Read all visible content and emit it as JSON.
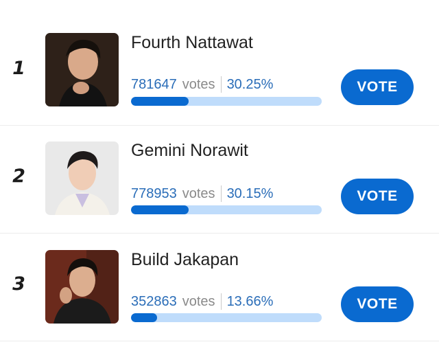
{
  "candidates": [
    {
      "rank": "1",
      "name": "Fourth Nattawat",
      "votes": "781647",
      "votes_label": "votes",
      "percent": "30.25%",
      "progress": 0.3025,
      "button_label": "VOTE",
      "photo_icon": "portrait-photo-fourth"
    },
    {
      "rank": "2",
      "name": "Gemini Norawit",
      "votes": "778953",
      "votes_label": "votes",
      "percent": "30.15%",
      "progress": 0.3015,
      "button_label": "VOTE",
      "photo_icon": "portrait-photo-gemini"
    },
    {
      "rank": "3",
      "name": "Build Jakapan",
      "votes": "352863",
      "votes_label": "votes",
      "percent": "13.66%",
      "progress": 0.1366,
      "button_label": "VOTE",
      "photo_icon": "portrait-photo-build"
    }
  ],
  "colors": {
    "accent": "#0a6ad0",
    "track": "#bfdcfb",
    "number_text": "#2a6db8"
  }
}
